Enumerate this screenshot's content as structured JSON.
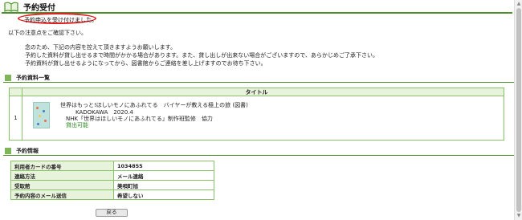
{
  "header": {
    "title": "予約受付",
    "icon": "open-book-icon"
  },
  "notice": "予約申込を受け付けました。",
  "intro": "以下の注意点をご確認下さい。",
  "notes": [
    "念のため、下記の内容を控えて頂きますようお願いします。",
    "予約した資料が貸し出せるまで時間がかかる場合があります。また、貸し出しが出来ない場合がございますので、あらかじめご了承下さい。",
    "予約資料が貸し出せるようになってから、図書館からご連絡を差し上げますのでお待ち下さい。"
  ],
  "reserved_section": {
    "title": "予約資料一覧",
    "column_title": "タイトル"
  },
  "reserved_items": [
    {
      "num": "1",
      "title": "世界はもっと!ほしいモノにあふれてる　バイヤーが教える極上の旅 (図書)",
      "publisher": "KADOKAWA　2020.4",
      "author": "NHK「世界はほしいモノにあふれてる」制作班監修　協力",
      "status": "貸出可能"
    }
  ],
  "info_section": {
    "title": "予約情報"
  },
  "info_rows": [
    {
      "key": "利用者カードの番号",
      "value": "1034855"
    },
    {
      "key": "連絡方法",
      "value": "メール連絡"
    },
    {
      "key": "受取館",
      "value": "美唄町旭"
    },
    {
      "key": "予約内容のメール送信",
      "value": "希望しない"
    }
  ],
  "back_button": "戻る",
  "colors": {
    "accent": "#4c8f2a",
    "highlight": "#e02020",
    "available": "#2e8b22"
  }
}
